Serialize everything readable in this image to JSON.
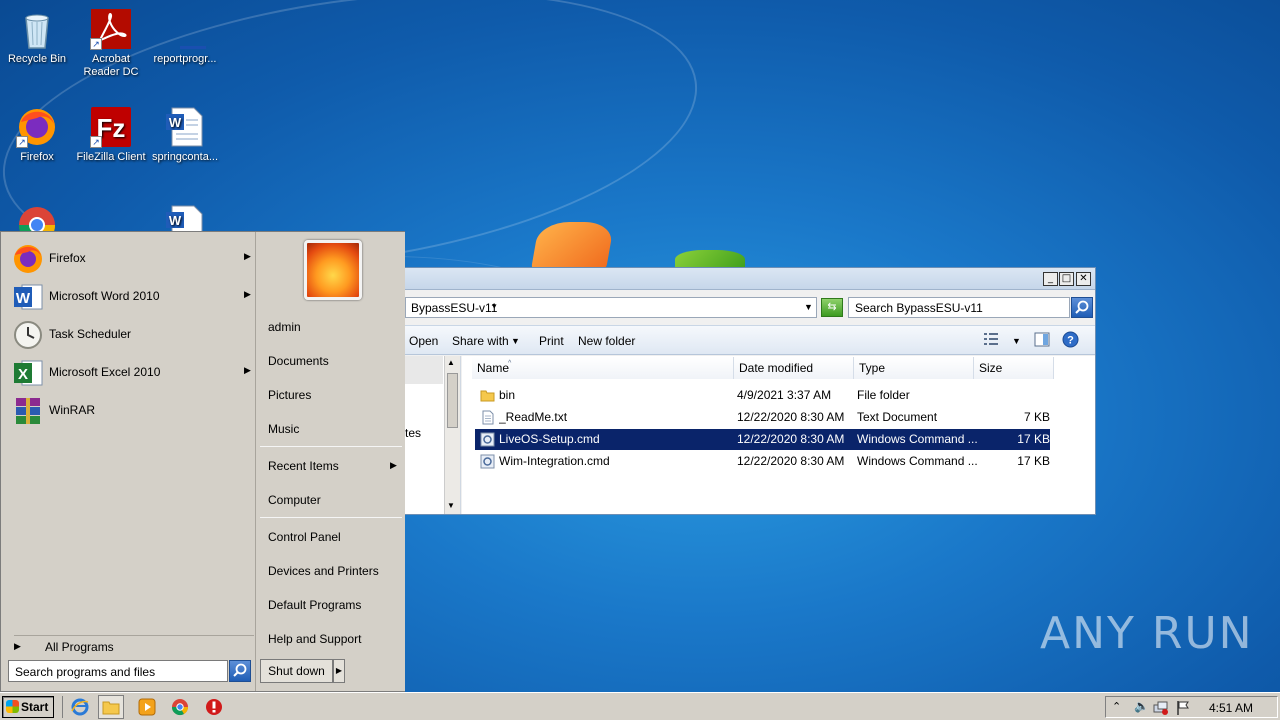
{
  "desktop": {
    "icons": [
      {
        "label": "Recycle Bin",
        "icon": "recycle-bin-icon"
      },
      {
        "label": "Acrobat Reader DC",
        "icon": "acrobat-icon"
      },
      {
        "label": "reportprogr...",
        "icon": "document-icon"
      },
      {
        "label": "Firefox",
        "icon": "firefox-icon"
      },
      {
        "label": "FileZilla Client",
        "icon": "filezilla-icon"
      },
      {
        "label": "springconta...",
        "icon": "word-doc-icon"
      },
      {
        "label": "",
        "icon": "chrome-icon"
      },
      {
        "label": "",
        "icon": "word-doc-icon"
      }
    ],
    "watermark": "ANY RUN"
  },
  "explorer": {
    "address": "BypassESU-v11",
    "search_placeholder": "Search BypassESU-v11",
    "toolbar": {
      "open": "Open",
      "share_with": "Share with",
      "print": "Print",
      "new_folder": "New folder"
    },
    "nav_fragment": "tes",
    "columns": [
      "Name",
      "Date modified",
      "Type",
      "Size"
    ],
    "rows": [
      {
        "name": "bin",
        "date": "4/9/2021 3:37 AM",
        "type": "File folder",
        "size": "",
        "icon": "folder-icon"
      },
      {
        "name": "_ReadMe.txt",
        "date": "12/22/2020 8:30 AM",
        "type": "Text Document",
        "size": "7 KB",
        "icon": "text-file-icon"
      },
      {
        "name": "LiveOS-Setup.cmd",
        "date": "12/22/2020 8:30 AM",
        "type": "Windows Command ...",
        "size": "17 KB",
        "icon": "cmd-file-icon",
        "selected": true
      },
      {
        "name": "Wim-Integration.cmd",
        "date": "12/22/2020 8:30 AM",
        "type": "Windows Command ...",
        "size": "17 KB",
        "icon": "cmd-file-icon"
      }
    ],
    "window_buttons": {
      "minimize": "_",
      "maximize": "□",
      "close": "✕"
    }
  },
  "start_menu": {
    "pinned": [
      {
        "label": "Firefox",
        "submenu": true
      },
      {
        "label": "Microsoft Word 2010",
        "submenu": true
      },
      {
        "label": "Task Scheduler",
        "submenu": false
      },
      {
        "label": "Microsoft Excel 2010",
        "submenu": true
      },
      {
        "label": "WinRAR",
        "submenu": false
      }
    ],
    "all_programs": "All Programs",
    "search_placeholder": "Search programs and files",
    "right": {
      "user": "admin",
      "documents": "Documents",
      "pictures": "Pictures",
      "music": "Music",
      "recent_items": "Recent Items",
      "computer": "Computer",
      "control_panel": "Control Panel",
      "devices_printers": "Devices and Printers",
      "default_programs": "Default Programs",
      "help_support": "Help and Support"
    },
    "shutdown": "Shut down"
  },
  "taskbar": {
    "start_label": "Start",
    "clock": "4:51 AM"
  }
}
